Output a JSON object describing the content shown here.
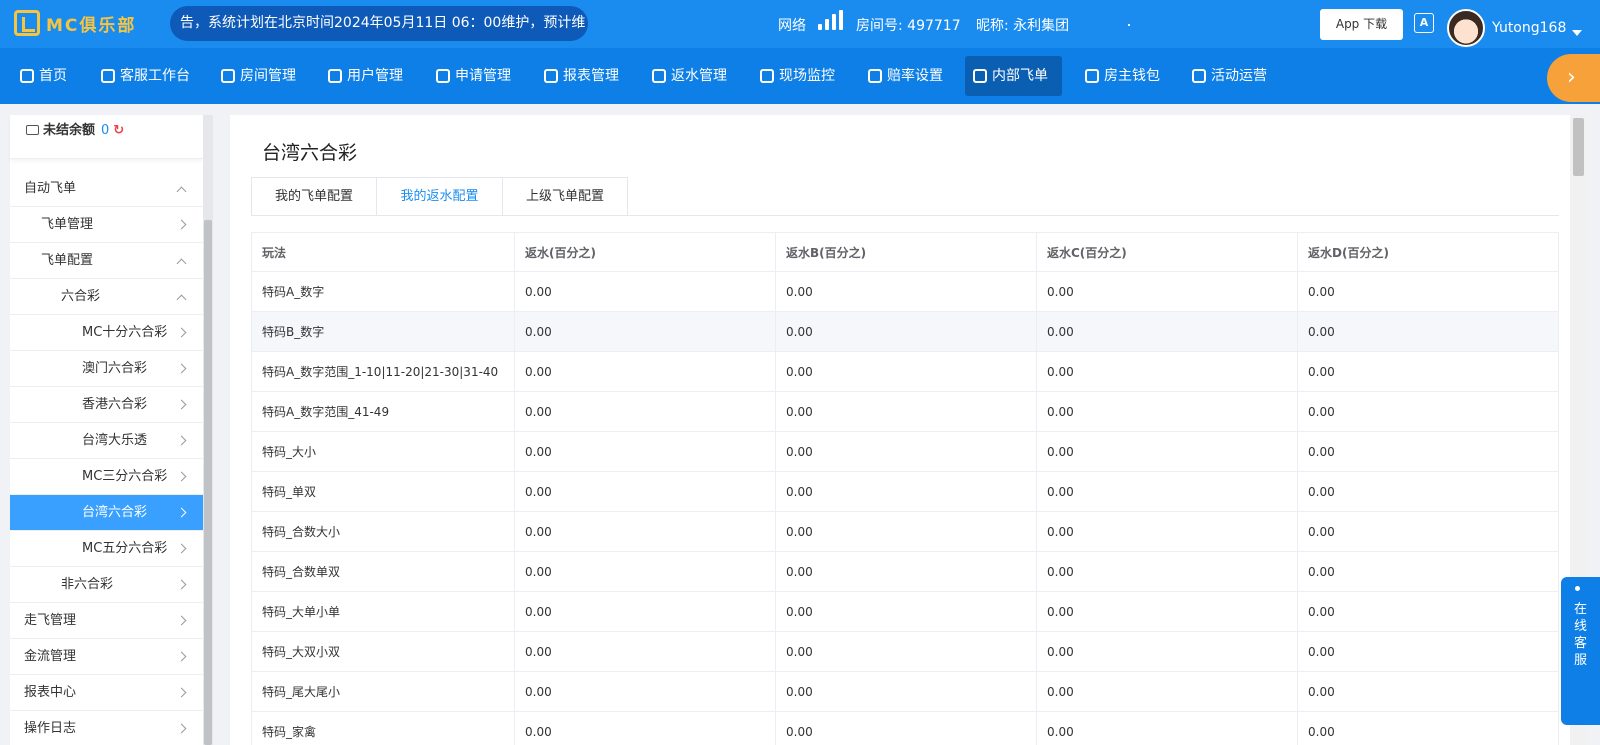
{
  "header": {
    "logo": "MC俱乐部",
    "notice": "告，系统计划在北京时间2024年05月11日 06：00维护，预计维",
    "network_label": "网络",
    "room": "房间号: 497717",
    "nickname": "昵称: 永利集团",
    "app_download": "App 下载",
    "translate_icon": "A",
    "username": "Yutong168"
  },
  "nav": {
    "items": [
      {
        "label": "首页",
        "icon": "home-icon"
      },
      {
        "label": "客服工作台",
        "icon": "headset-icon"
      },
      {
        "label": "房间管理",
        "icon": "grid-icon"
      },
      {
        "label": "用户管理",
        "icon": "user-icon"
      },
      {
        "label": "申请管理",
        "icon": "document-icon"
      },
      {
        "label": "报表管理",
        "icon": "bar-chart-icon"
      },
      {
        "label": "返水管理",
        "icon": "tag-icon"
      },
      {
        "label": "现场监控",
        "icon": "monitor-icon"
      },
      {
        "label": "赔率设置",
        "icon": "shield-icon"
      },
      {
        "label": "内部飞单",
        "icon": "refresh-icon"
      },
      {
        "label": "房主钱包",
        "icon": "wallet-icon"
      },
      {
        "label": "活动运营",
        "icon": "gift-icon"
      }
    ],
    "active": "内部飞单"
  },
  "sidebar": {
    "balance_label": "未结余额",
    "balance_value": "0",
    "items": [
      {
        "label": "自动飞单"
      },
      {
        "label": "飞单管理"
      },
      {
        "label": "飞单配置"
      },
      {
        "label": "六合彩"
      },
      {
        "label": "MC十分六合彩"
      },
      {
        "label": "澳门六合彩"
      },
      {
        "label": "香港六合彩"
      },
      {
        "label": "台湾大乐透"
      },
      {
        "label": "MC三分六合彩"
      },
      {
        "label": "台湾六合彩"
      },
      {
        "label": "MC五分六合彩"
      },
      {
        "label": "非六合彩"
      },
      {
        "label": "走飞管理"
      },
      {
        "label": "金流管理"
      },
      {
        "label": "报表中心"
      },
      {
        "label": "操作日志"
      }
    ]
  },
  "main": {
    "title": "台湾六合彩",
    "tabs": [
      "我的飞单配置",
      "我的返水配置",
      "上级飞单配置"
    ],
    "active_tab": "我的返水配置",
    "table": {
      "columns": [
        "玩法",
        "返水(百分之)",
        "返水B(百分之)",
        "返水C(百分之)",
        "返水D(百分之)"
      ],
      "rows": [
        [
          "特码A_数字",
          "0.00",
          "0.00",
          "0.00",
          "0.00"
        ],
        [
          "特码B_数字",
          "0.00",
          "0.00",
          "0.00",
          "0.00"
        ],
        [
          "特码A_数字范围_1-10|11-20|21-30|31-40",
          "0.00",
          "0.00",
          "0.00",
          "0.00"
        ],
        [
          "特码A_数字范围_41-49",
          "0.00",
          "0.00",
          "0.00",
          "0.00"
        ],
        [
          "特码_大小",
          "0.00",
          "0.00",
          "0.00",
          "0.00"
        ],
        [
          "特码_单双",
          "0.00",
          "0.00",
          "0.00",
          "0.00"
        ],
        [
          "特码_合数大小",
          "0.00",
          "0.00",
          "0.00",
          "0.00"
        ],
        [
          "特码_合数单双",
          "0.00",
          "0.00",
          "0.00",
          "0.00"
        ],
        [
          "特码_大单小单",
          "0.00",
          "0.00",
          "0.00",
          "0.00"
        ],
        [
          "特码_大双小双",
          "0.00",
          "0.00",
          "0.00",
          "0.00"
        ],
        [
          "特码_尾大尾小",
          "0.00",
          "0.00",
          "0.00",
          "0.00"
        ],
        [
          "特码_家禽",
          "0.00",
          "0.00",
          "0.00",
          "0.00"
        ]
      ]
    }
  },
  "service_button": "在线客服",
  "colors": {
    "topbar": "#1a8cf0",
    "nav": "#0e7fe6",
    "accent": "#3aa0ff",
    "more_button": "#f6a13a"
  }
}
